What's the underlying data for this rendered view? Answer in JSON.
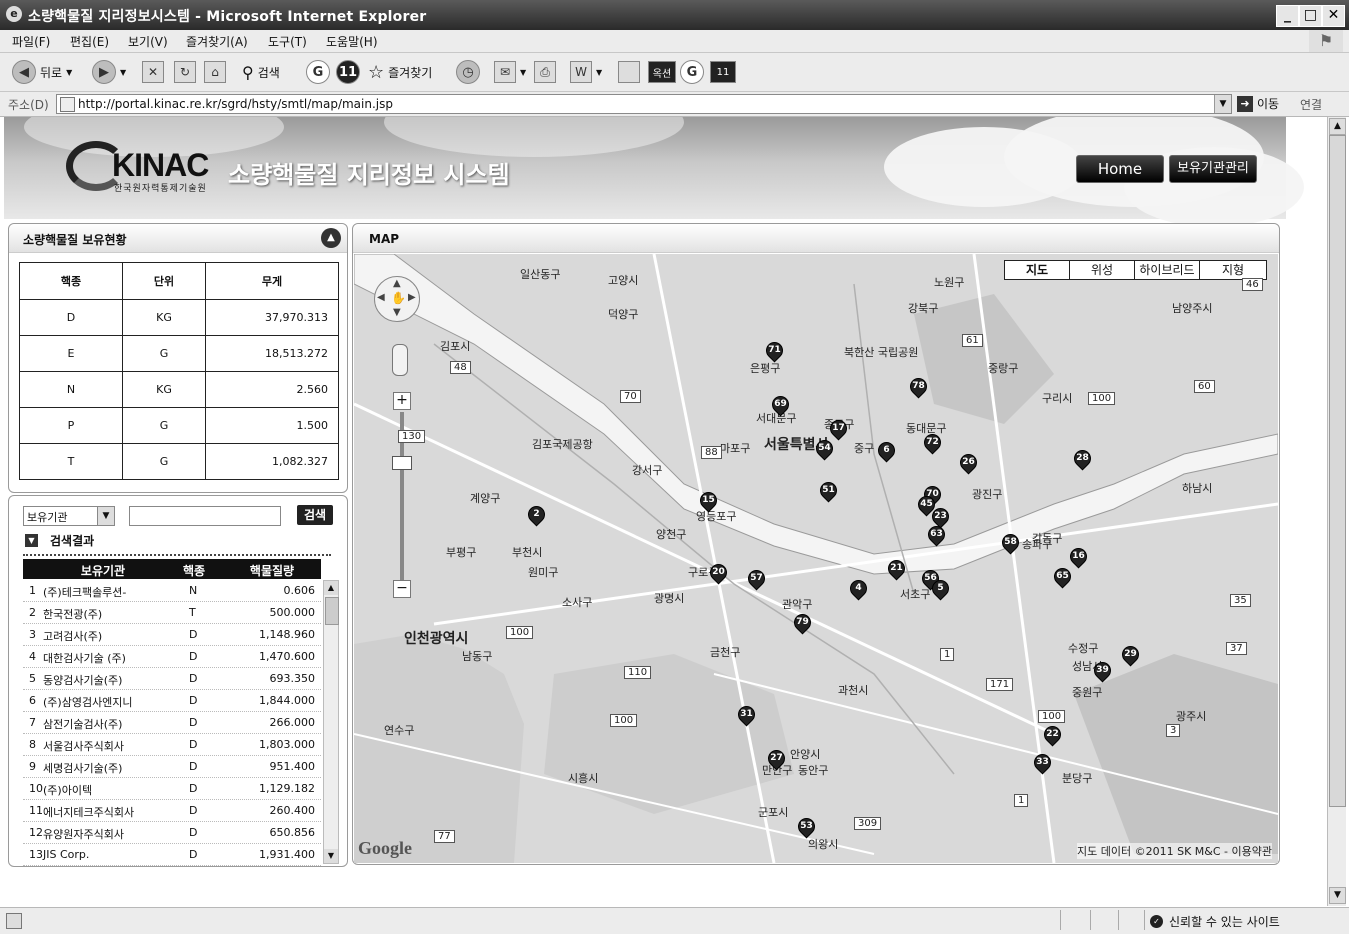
{
  "window": {
    "title": "소량핵물질 지리정보시스템 - Microsoft Internet Explorer",
    "buttons": [
      "_",
      "□",
      "✕"
    ]
  },
  "menu": [
    "파일(F)",
    "편집(E)",
    "보기(V)",
    "즐겨찾기(A)",
    "도구(T)",
    "도움말(H)"
  ],
  "toolbar": {
    "back": "뒤로",
    "search": "검색",
    "favorites": "즐겨찾기",
    "cyworld": "싸이",
    "ext_label": "옥션"
  },
  "address": {
    "label": "주소(D)",
    "url": "http://portal.kinac.re.kr/sgrd/hsty/smtl/map/main.jsp",
    "go": "이동",
    "links": "연결"
  },
  "header": {
    "logo_text": "KINAC",
    "logo_sub": "한국원자력통제기술원",
    "site_title": "소량핵물질 지리정보 시스템",
    "home_button": "Home",
    "manage_button": "보유기관관리"
  },
  "inventory": {
    "title": "소량핵물질 보유현황",
    "columns": [
      "핵종",
      "단위",
      "무게"
    ],
    "rows": [
      [
        "D",
        "KG",
        "37,970.313"
      ],
      [
        "E",
        "G",
        "18,513.272"
      ],
      [
        "N",
        "KG",
        "2.560"
      ],
      [
        "P",
        "G",
        "1.500"
      ],
      [
        "T",
        "G",
        "1,082.327"
      ]
    ]
  },
  "search": {
    "select_value": "보유기관",
    "button": "검색",
    "results_title": "검색결과",
    "columns": [
      "보유기관",
      "핵종",
      "핵물질량"
    ],
    "rows": [
      [
        "1",
        "(주)테크팩솔루션-",
        "N",
        "0.606"
      ],
      [
        "2",
        "한국전광(주)",
        "T",
        "500.000"
      ],
      [
        "3",
        "고려검사(주)",
        "D",
        "1,148.960"
      ],
      [
        "4",
        "대한검사기술 (주)",
        "D",
        "1,470.600"
      ],
      [
        "5",
        "동양검사기술(주)",
        "D",
        "693.350"
      ],
      [
        "6",
        "(주)삼영검사엔지니",
        "D",
        "1,844.000"
      ],
      [
        "7",
        "삼전기술검사(주)",
        "D",
        "266.000"
      ],
      [
        "8",
        "서울검사주식회사",
        "D",
        "1,803.000"
      ],
      [
        "9",
        "세명검사기술(주)",
        "D",
        "951.400"
      ],
      [
        "10",
        "(주)아이텍",
        "D",
        "1,129.182"
      ],
      [
        "11",
        "에너지테크주식회사",
        "D",
        "260.400"
      ],
      [
        "12",
        "유양원자주식회사",
        "D",
        "650.856"
      ],
      [
        "13",
        "JIS Corp.",
        "D",
        "1,931.400"
      ]
    ]
  },
  "map": {
    "title": "MAP",
    "types": [
      "지도",
      "위성",
      "하이브리드",
      "지형"
    ],
    "places": [
      {
        "name": "일산동구"
      },
      {
        "name": "고양시"
      },
      {
        "name": "덕양구"
      },
      {
        "name": "김포시"
      },
      {
        "name": "은평구"
      },
      {
        "name": "북한산 국립공원"
      },
      {
        "name": "강북구"
      },
      {
        "name": "노원구"
      },
      {
        "name": "남양주시"
      },
      {
        "name": "중랑구"
      },
      {
        "name": "구리시"
      },
      {
        "name": "서대문구"
      },
      {
        "name": "종로구"
      },
      {
        "name": "동대문구"
      },
      {
        "name": "마포구"
      },
      {
        "name": "서울특별시"
      },
      {
        "name": "중구"
      },
      {
        "name": "김포국제공항"
      },
      {
        "name": "강서구"
      },
      {
        "name": "광진구"
      },
      {
        "name": "하남시"
      },
      {
        "name": "계양구"
      },
      {
        "name": "영등포구"
      },
      {
        "name": "양천구"
      },
      {
        "name": "강동구"
      },
      {
        "name": "부평구"
      },
      {
        "name": "부천시"
      },
      {
        "name": "원미구"
      },
      {
        "name": "구로구"
      },
      {
        "name": "서초구"
      },
      {
        "name": "송파구"
      },
      {
        "name": "소사구"
      },
      {
        "name": "광명시"
      },
      {
        "name": "관악구"
      },
      {
        "name": "인천광역시"
      },
      {
        "name": "남동구"
      },
      {
        "name": "금천구"
      },
      {
        "name": "수정구"
      },
      {
        "name": "성남시"
      },
      {
        "name": "중원구"
      },
      {
        "name": "과천시"
      },
      {
        "name": "연수구"
      },
      {
        "name": "광주시"
      },
      {
        "name": "안양시"
      },
      {
        "name": "만안구"
      },
      {
        "name": "동안구"
      },
      {
        "name": "시흥시"
      },
      {
        "name": "분당구"
      },
      {
        "name": "군포시"
      },
      {
        "name": "의왕시"
      }
    ],
    "markers": [
      "71",
      "69",
      "17",
      "54",
      "6",
      "78",
      "72",
      "26",
      "28",
      "2",
      "15",
      "51",
      "70",
      "45",
      "23",
      "63",
      "58",
      "16",
      "65",
      "20",
      "57",
      "4",
      "21",
      "56",
      "5",
      "79",
      "29",
      "39",
      "31",
      "27",
      "22",
      "33",
      "53"
    ],
    "credit": "지도 데이터 ©2011 SK M&C - 이용약관",
    "powered_by": "Google"
  },
  "status": {
    "trusted": "신뢰할 수 있는 사이트"
  }
}
